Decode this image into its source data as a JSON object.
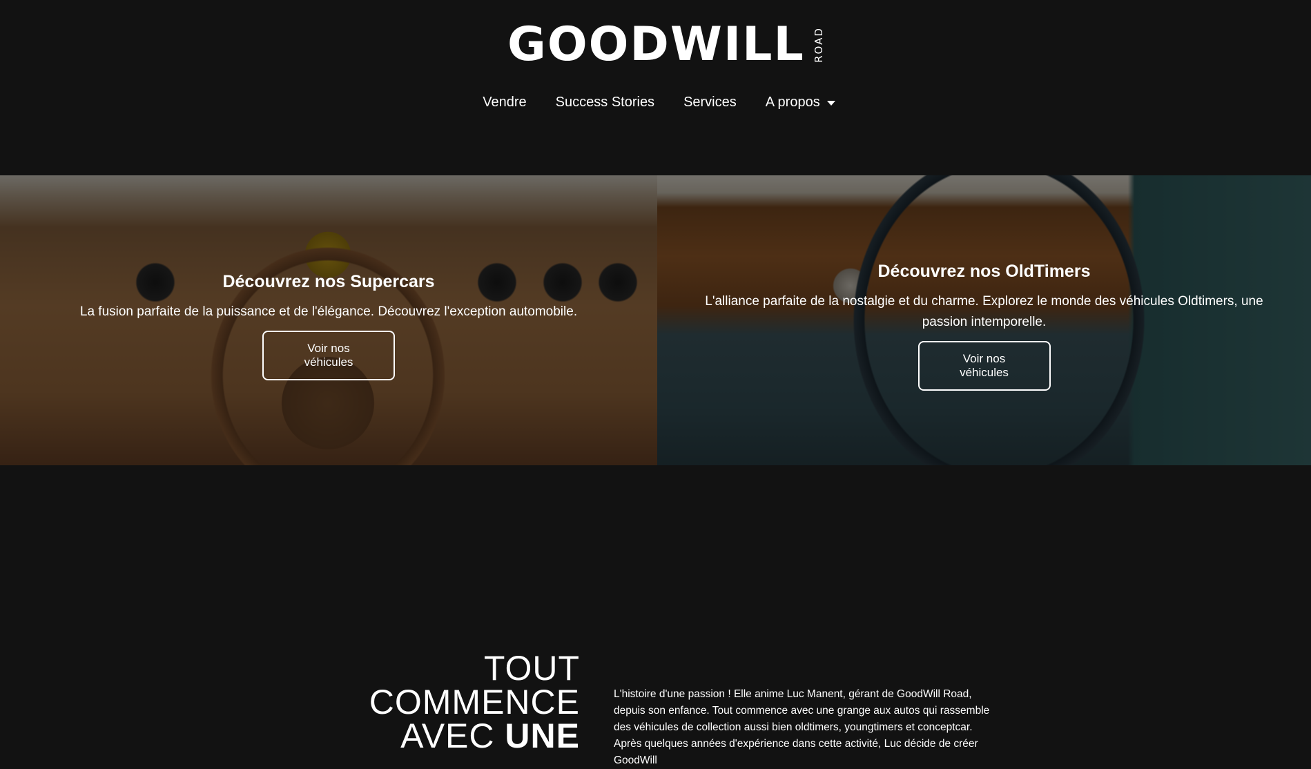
{
  "header": {
    "logo": {
      "text": "GOODWILL",
      "subtext": "ROAD"
    },
    "nav": [
      {
        "label": "Vendre"
      },
      {
        "label": "Success Stories"
      },
      {
        "label": "Services"
      },
      {
        "label": "A propos",
        "icon": "chevron-down-icon"
      }
    ]
  },
  "hero": {
    "supercars": {
      "title": "Découvrez nos Supercars",
      "text": "La fusion parfaite de la puissance et de l'élégance. Découvrez l'exception automobile.",
      "button": "Voir nos véhicules"
    },
    "oldtimers": {
      "title": "Découvrez nos OldTimers",
      "text": "L'alliance parfaite de la nostalgie et du charme. Explorez le monde des véhicules Oldtimers, une passion intemporelle.",
      "button": "Voir nos véhicules"
    }
  },
  "story": {
    "heading_line1": "TOUT",
    "heading_line2": "COMMENCE",
    "heading_line3_regular": "AVEC",
    "heading_line3_bold": "UNE",
    "text": "L'histoire d'une passion ! Elle anime Luc Manent, gérant de GoodWill Road, depuis son enfance. Tout commence avec une grange aux autos qui rassemble des véhicules de collection aussi bien oldtimers, youngtimers et conceptcar. Après quelques années d'expérience dans cette activité, Luc décide de créer GoodWill"
  },
  "colors": {
    "background": "#121212",
    "text": "#ffffff",
    "overlay": "rgba(0,0,0,0.5)"
  }
}
